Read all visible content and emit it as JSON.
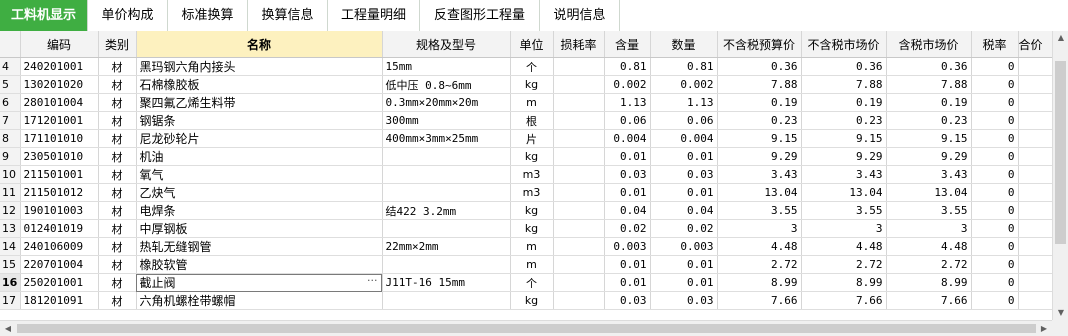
{
  "tabs": [
    {
      "label": "工料机显示",
      "active": true
    },
    {
      "label": "单价构成"
    },
    {
      "label": "标准换算"
    },
    {
      "label": "换算信息"
    },
    {
      "label": "工程量明细"
    },
    {
      "label": "反查图形工程量"
    },
    {
      "label": "说明信息"
    }
  ],
  "columns": [
    "",
    "编码",
    "类别",
    "名称",
    "规格及型号",
    "单位",
    "损耗率",
    "含量",
    "数量",
    "不含税预算价",
    "不含税市场价",
    "含税市场价",
    "税率",
    "合价"
  ],
  "selected_column": "名称",
  "current_row": "16",
  "rows": [
    {
      "rn": "4",
      "code": "240201001",
      "cat": "材",
      "name": "黑玛钢六角内接头",
      "spec": "15mm",
      "unit": "个",
      "loss": "",
      "content": "0.81",
      "qty": "0.81",
      "budget": "0.36",
      "market": "0.36",
      "taxmarket": "0.36",
      "tax": "0"
    },
    {
      "rn": "5",
      "code": "130201020",
      "cat": "材",
      "name": "石棉橡胶板",
      "spec": "低中压 0.8~6mm",
      "unit": "kg",
      "loss": "",
      "content": "0.002",
      "qty": "0.002",
      "budget": "7.88",
      "market": "7.88",
      "taxmarket": "7.88",
      "tax": "0"
    },
    {
      "rn": "6",
      "code": "280101004",
      "cat": "材",
      "name": "聚四氟乙烯生料带",
      "spec": "0.3mm×20mm×20m",
      "unit": "m",
      "loss": "",
      "content": "1.13",
      "qty": "1.13",
      "budget": "0.19",
      "market": "0.19",
      "taxmarket": "0.19",
      "tax": "0"
    },
    {
      "rn": "7",
      "code": "171201001",
      "cat": "材",
      "name": "钢锯条",
      "spec": "300mm",
      "unit": "根",
      "loss": "",
      "content": "0.06",
      "qty": "0.06",
      "budget": "0.23",
      "market": "0.23",
      "taxmarket": "0.23",
      "tax": "0"
    },
    {
      "rn": "8",
      "code": "171101010",
      "cat": "材",
      "name": "尼龙砂轮片",
      "spec": "400mm×3mm×25mm",
      "unit": "片",
      "loss": "",
      "content": "0.004",
      "qty": "0.004",
      "budget": "9.15",
      "market": "9.15",
      "taxmarket": "9.15",
      "tax": "0"
    },
    {
      "rn": "9",
      "code": "230501010",
      "cat": "材",
      "name": "机油",
      "spec": "",
      "unit": "kg",
      "loss": "",
      "content": "0.01",
      "qty": "0.01",
      "budget": "9.29",
      "market": "9.29",
      "taxmarket": "9.29",
      "tax": "0"
    },
    {
      "rn": "10",
      "code": "211501001",
      "cat": "材",
      "name": "氧气",
      "spec": "",
      "unit": "m3",
      "loss": "",
      "content": "0.03",
      "qty": "0.03",
      "budget": "3.43",
      "market": "3.43",
      "taxmarket": "3.43",
      "tax": "0"
    },
    {
      "rn": "11",
      "code": "211501012",
      "cat": "材",
      "name": "乙炔气",
      "spec": "",
      "unit": "m3",
      "loss": "",
      "content": "0.01",
      "qty": "0.01",
      "budget": "13.04",
      "market": "13.04",
      "taxmarket": "13.04",
      "tax": "0"
    },
    {
      "rn": "12",
      "code": "190101003",
      "cat": "材",
      "name": "电焊条",
      "spec": "结422 3.2mm",
      "unit": "kg",
      "loss": "",
      "content": "0.04",
      "qty": "0.04",
      "budget": "3.55",
      "market": "3.55",
      "taxmarket": "3.55",
      "tax": "0"
    },
    {
      "rn": "13",
      "code": "012401019",
      "cat": "材",
      "name": "中厚钢板",
      "spec": "",
      "unit": "kg",
      "loss": "",
      "content": "0.02",
      "qty": "0.02",
      "budget": "3",
      "market": "3",
      "taxmarket": "3",
      "tax": "0"
    },
    {
      "rn": "14",
      "code": "240106009",
      "cat": "材",
      "name": "热轧无缝钢管",
      "spec": "22mm×2mm",
      "unit": "m",
      "loss": "",
      "content": "0.003",
      "qty": "0.003",
      "budget": "4.48",
      "market": "4.48",
      "taxmarket": "4.48",
      "tax": "0"
    },
    {
      "rn": "15",
      "code": "220701004",
      "cat": "材",
      "name": "橡胶软管",
      "spec": "",
      "unit": "m",
      "loss": "",
      "content": "0.01",
      "qty": "0.01",
      "budget": "2.72",
      "market": "2.72",
      "taxmarket": "2.72",
      "tax": "0"
    },
    {
      "rn": "16",
      "code": "250201001",
      "cat": "材",
      "name": "截止阀",
      "spec": "J11T-16 15mm",
      "unit": "个",
      "loss": "",
      "content": "0.01",
      "qty": "0.01",
      "budget": "8.99",
      "market": "8.99",
      "taxmarket": "8.99",
      "tax": "0"
    },
    {
      "rn": "17",
      "code": "181201091",
      "cat": "材",
      "name": "六角机螺栓带螺帽",
      "spec": "",
      "unit": "kg",
      "loss": "",
      "content": "0.03",
      "qty": "0.03",
      "budget": "7.66",
      "market": "7.66",
      "taxmarket": "7.66",
      "tax": "0"
    }
  ],
  "icons": {
    "ellipsis": "ellipsis-icon",
    "up": "arrow-up-icon",
    "down": "arrow-down-icon",
    "left": "arrow-left-icon",
    "right": "arrow-right-icon"
  },
  "colors": {
    "active_tab": "#3fae42",
    "selected_header": "#fdf1bf"
  }
}
